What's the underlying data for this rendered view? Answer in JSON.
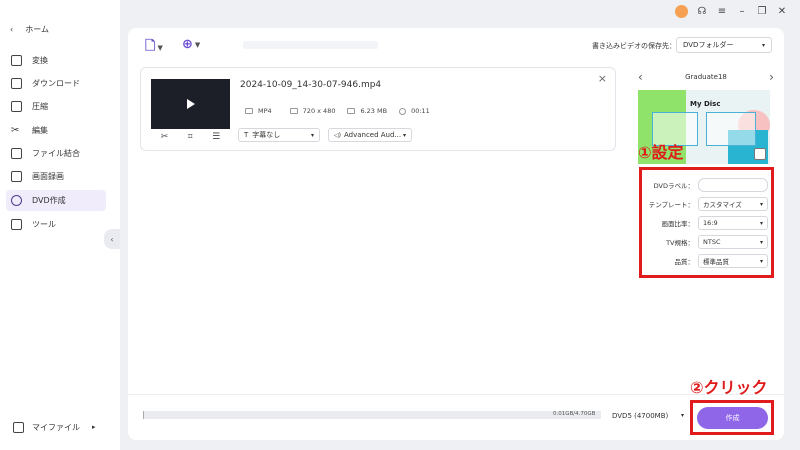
{
  "sidebar": {
    "back_label": "ホーム",
    "items": [
      {
        "label": "変換",
        "icon": "convert-icon"
      },
      {
        "label": "ダウンロード",
        "icon": "download-icon"
      },
      {
        "label": "圧縮",
        "icon": "compress-icon"
      },
      {
        "label": "編集",
        "icon": "scissors-icon"
      },
      {
        "label": "ファイル結合",
        "icon": "merge-icon"
      },
      {
        "label": "画面録画",
        "icon": "screen-record-icon"
      },
      {
        "label": "DVD作成",
        "icon": "disc-icon",
        "active": true
      },
      {
        "label": "ツール",
        "icon": "tools-icon"
      }
    ],
    "my_files_label": "マイファイル"
  },
  "header": {
    "save_dest_label": "書き込みビデオの保存先：",
    "save_dest_value": "DVDフォルダー"
  },
  "file": {
    "name": "2024-10-09_14-30-07-946.mp4",
    "format": "MP4",
    "resolution": "720 x 480",
    "size": "6.23 MB",
    "duration": "00:11",
    "subtitle_value": "字幕なし",
    "audio_value": "Advanced Aud..."
  },
  "disc": {
    "template_name": "Graduate18",
    "preview_title": "My Disc"
  },
  "settings": {
    "rows": [
      {
        "label": "DVDラベル：",
        "value": ""
      },
      {
        "label": "テンプレート：",
        "value": "カスタマイズ"
      },
      {
        "label": "画面比率：",
        "value": "16:9"
      },
      {
        "label": "TV規格：",
        "value": "NTSC"
      },
      {
        "label": "品質：",
        "value": "標準品質"
      }
    ]
  },
  "annotations": {
    "step1": "①設定",
    "step2": "②クリック",
    "color": "#e01b1b"
  },
  "footer": {
    "capacity": "0.01GB/4.70GB",
    "disc_type": "DVD5 (4700MB)",
    "create_label": "作成"
  },
  "colors": {
    "accent": "#9066e8",
    "annotation_red": "#e01b1b"
  }
}
